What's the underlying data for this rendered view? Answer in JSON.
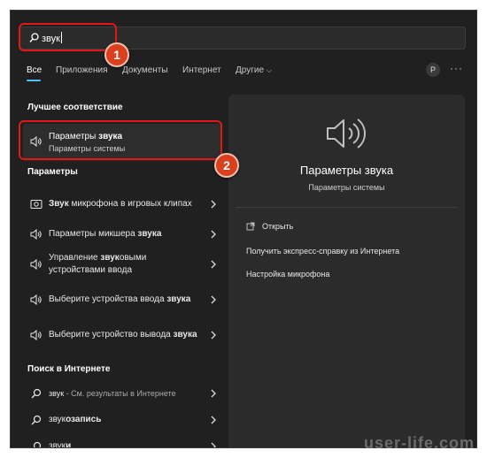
{
  "search": {
    "value": "звук"
  },
  "tabs": [
    {
      "label": "Все",
      "active": true
    },
    {
      "label": "Приложения"
    },
    {
      "label": "Документы"
    },
    {
      "label": "Интернет"
    },
    {
      "label": "Другие"
    }
  ],
  "header": {
    "avatar": "P",
    "more": "···"
  },
  "best_match": {
    "heading": "Лучшее соответствие",
    "title_prefix": "Параметры ",
    "title_bold": "звука",
    "subtitle": "Параметры системы"
  },
  "settings": {
    "heading": "Параметры",
    "items": [
      {
        "pre": "",
        "bold": "Звук",
        "post": " микрофона в игровых клипах",
        "icon": "camera-icon"
      },
      {
        "pre": "Параметры микшера ",
        "bold": "звука",
        "post": "",
        "icon": "speaker-icon"
      },
      {
        "pre": "Управление ",
        "bold": "звук",
        "post": "овыми устройствами ввода",
        "icon": "speaker-icon"
      },
      {
        "pre": "Выберите устройства ввода ",
        "bold": "звука",
        "post": "",
        "icon": "speaker-icon"
      },
      {
        "pre": "Выберите устройство вывода ",
        "bold": "звука",
        "post": "",
        "icon": "speaker-icon"
      }
    ]
  },
  "web": {
    "heading": "Поиск в Интернете",
    "items": [
      {
        "bold": "",
        "pre": "звук",
        "post": " - См. результаты в Интернете"
      },
      {
        "pre": "",
        "bold": "звук",
        "post": "озапись"
      },
      {
        "pre": "",
        "bold": "звук",
        "post": "и"
      }
    ]
  },
  "details": {
    "title": "Параметры звука",
    "subtitle": "Параметры системы",
    "actions": [
      "Открыть",
      "Получить экспресс-справку из Интернета",
      "Настройка микрофона"
    ]
  },
  "annotations": {
    "badge1": "1",
    "badge2": "2"
  },
  "watermark": "user-life.com",
  "colors": {
    "accent": "#4cc2ff",
    "highlight": "#e21818",
    "badge": "#d9401e"
  }
}
